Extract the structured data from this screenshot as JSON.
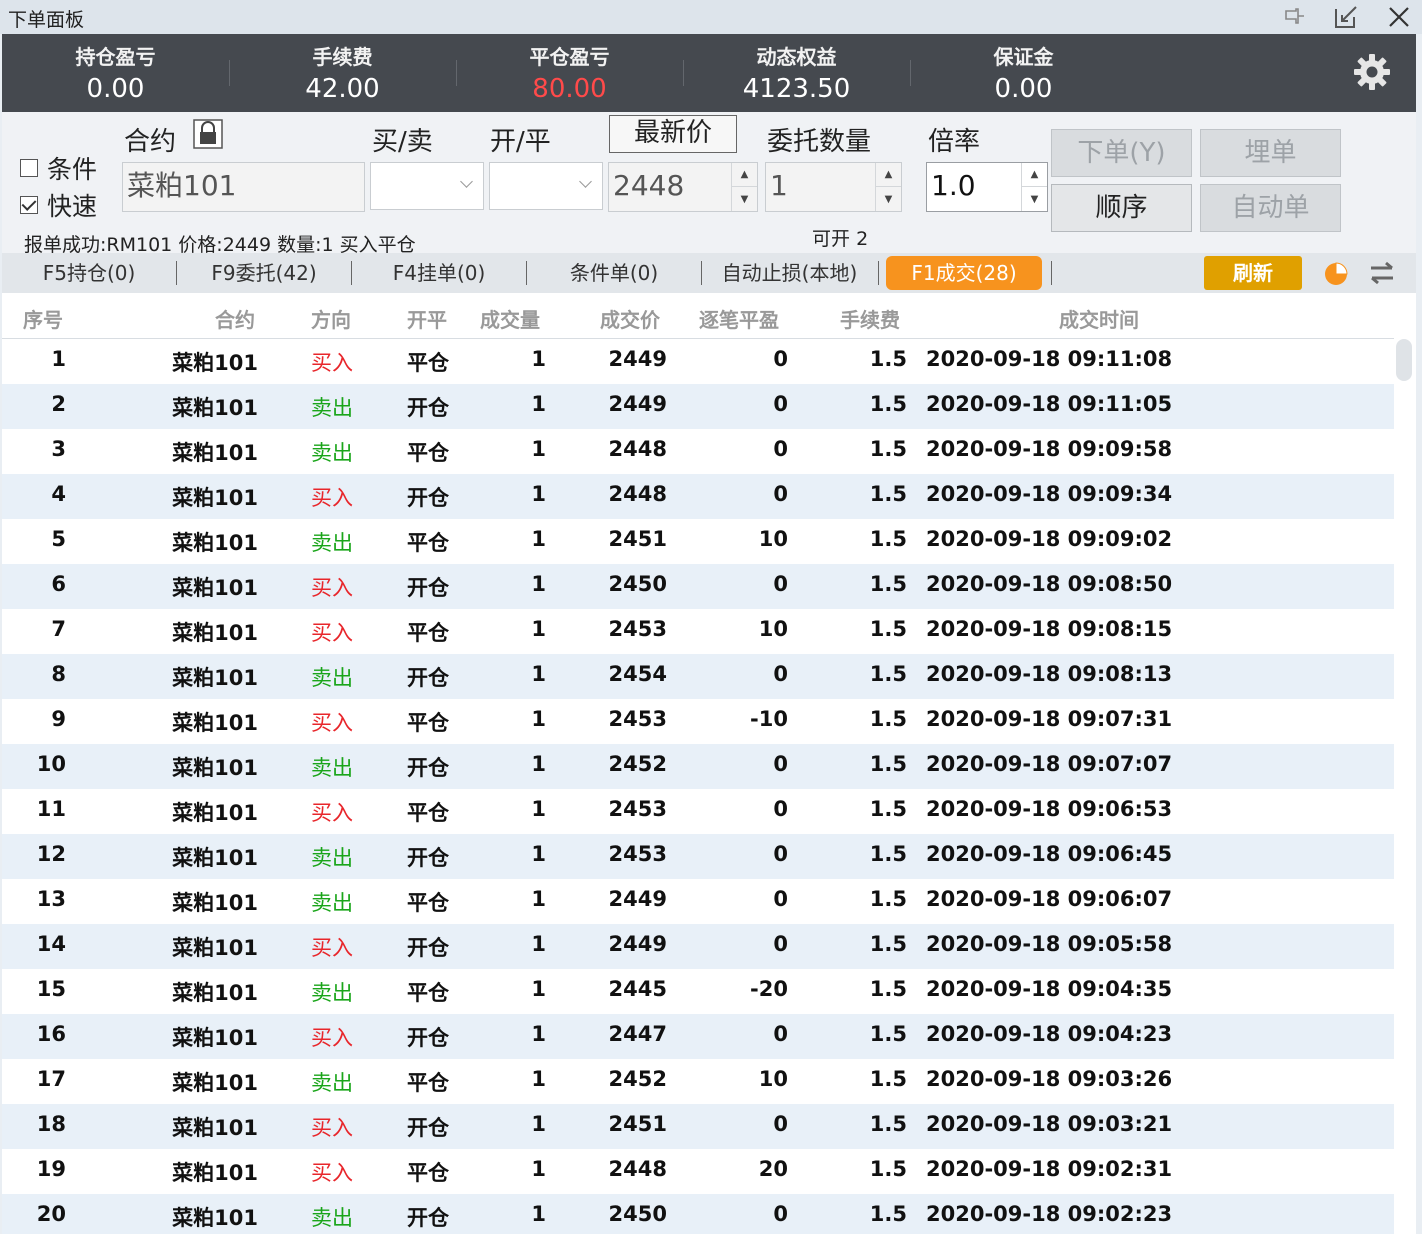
{
  "window": {
    "title": "下单面板",
    "icons": [
      "pin-icon",
      "edit-icon",
      "close-icon"
    ]
  },
  "summary": [
    {
      "label": "持仓盈亏",
      "value": "0.00",
      "highlight": false
    },
    {
      "label": "手续费",
      "value": "42.00",
      "highlight": false
    },
    {
      "label": "平仓盈亏",
      "value": "80.00",
      "highlight": true
    },
    {
      "label": "动态权益",
      "value": "4123.50",
      "highlight": false
    },
    {
      "label": "保证金",
      "value": "0.00",
      "highlight": false
    }
  ],
  "order": {
    "condition_label": "条件",
    "condition_checked": false,
    "fast_label": "快速",
    "fast_checked": true,
    "contract_label": "合约",
    "contract_value": "菜粕101",
    "buysell_label": "买/卖",
    "openclose_label": "开/平",
    "latest_price_label": "最新价",
    "price_value": "2448",
    "quantity_label": "委托数量",
    "quantity_value": "1",
    "multiplier_label": "倍率",
    "multiplier_value": "1.0",
    "place_order_label": "下单(Y)",
    "hidden_order_label": "埋单",
    "sequence_label": "顺序",
    "auto_order_label": "自动单",
    "status_message": "报单成功:RM101 价格:2449  数量:1 买入平仓",
    "can_open_label": "可开",
    "can_open_value": "2"
  },
  "tabs": [
    {
      "label": "F5持仓(0)",
      "active": false
    },
    {
      "label": "F9委托(42)",
      "active": false
    },
    {
      "label": "F4挂单(0)",
      "active": false
    },
    {
      "label": "条件单(0)",
      "active": false
    },
    {
      "label": "自动止损(本地)",
      "active": false
    },
    {
      "label": "F1成交(28)",
      "active": true
    }
  ],
  "refresh_label": "刷新",
  "colors": {
    "buy": "#e8262b",
    "sell": "#1aa51a",
    "active_tab": "#f7931e",
    "refresh": "#e0a000"
  },
  "table": {
    "headers": [
      "序号",
      "合约",
      "方向",
      "开平",
      "成交量",
      "成交价",
      "逐笔平盈",
      "手续费",
      "成交时间"
    ],
    "rows": [
      [
        "1",
        "菜粕101",
        "买入",
        "平仓",
        "1",
        "2449",
        "0",
        "1.5",
        "2020-09-18 09:11:08"
      ],
      [
        "2",
        "菜粕101",
        "卖出",
        "开仓",
        "1",
        "2449",
        "0",
        "1.5",
        "2020-09-18 09:11:05"
      ],
      [
        "3",
        "菜粕101",
        "卖出",
        "平仓",
        "1",
        "2448",
        "0",
        "1.5",
        "2020-09-18 09:09:58"
      ],
      [
        "4",
        "菜粕101",
        "买入",
        "开仓",
        "1",
        "2448",
        "0",
        "1.5",
        "2020-09-18 09:09:34"
      ],
      [
        "5",
        "菜粕101",
        "卖出",
        "平仓",
        "1",
        "2451",
        "10",
        "1.5",
        "2020-09-18 09:09:02"
      ],
      [
        "6",
        "菜粕101",
        "买入",
        "开仓",
        "1",
        "2450",
        "0",
        "1.5",
        "2020-09-18 09:08:50"
      ],
      [
        "7",
        "菜粕101",
        "买入",
        "平仓",
        "1",
        "2453",
        "10",
        "1.5",
        "2020-09-18 09:08:15"
      ],
      [
        "8",
        "菜粕101",
        "卖出",
        "开仓",
        "1",
        "2454",
        "0",
        "1.5",
        "2020-09-18 09:08:13"
      ],
      [
        "9",
        "菜粕101",
        "买入",
        "平仓",
        "1",
        "2453",
        "-10",
        "1.5",
        "2020-09-18 09:07:31"
      ],
      [
        "10",
        "菜粕101",
        "卖出",
        "开仓",
        "1",
        "2452",
        "0",
        "1.5",
        "2020-09-18 09:07:07"
      ],
      [
        "11",
        "菜粕101",
        "买入",
        "平仓",
        "1",
        "2453",
        "0",
        "1.5",
        "2020-09-18 09:06:53"
      ],
      [
        "12",
        "菜粕101",
        "卖出",
        "开仓",
        "1",
        "2453",
        "0",
        "1.5",
        "2020-09-18 09:06:45"
      ],
      [
        "13",
        "菜粕101",
        "卖出",
        "平仓",
        "1",
        "2449",
        "0",
        "1.5",
        "2020-09-18 09:06:07"
      ],
      [
        "14",
        "菜粕101",
        "买入",
        "开仓",
        "1",
        "2449",
        "0",
        "1.5",
        "2020-09-18 09:05:58"
      ],
      [
        "15",
        "菜粕101",
        "卖出",
        "平仓",
        "1",
        "2445",
        "-20",
        "1.5",
        "2020-09-18 09:04:35"
      ],
      [
        "16",
        "菜粕101",
        "买入",
        "开仓",
        "1",
        "2447",
        "0",
        "1.5",
        "2020-09-18 09:04:23"
      ],
      [
        "17",
        "菜粕101",
        "卖出",
        "平仓",
        "1",
        "2452",
        "10",
        "1.5",
        "2020-09-18 09:03:26"
      ],
      [
        "18",
        "菜粕101",
        "买入",
        "开仓",
        "1",
        "2451",
        "0",
        "1.5",
        "2020-09-18 09:03:21"
      ],
      [
        "19",
        "菜粕101",
        "买入",
        "平仓",
        "1",
        "2448",
        "20",
        "1.5",
        "2020-09-18 09:02:31"
      ],
      [
        "20",
        "菜粕101",
        "卖出",
        "开仓",
        "1",
        "2450",
        "0",
        "1.5",
        "2020-09-18 09:02:23"
      ]
    ]
  }
}
